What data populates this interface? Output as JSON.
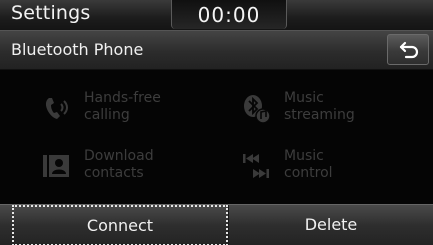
{
  "status_bar": {
    "app_title": "Settings",
    "clock": "00:00"
  },
  "header": {
    "title": "Bluetooth Phone",
    "back_icon": "back-arrow-icon"
  },
  "features": [
    {
      "label": "Hands-free\ncalling",
      "icon": "phone-icon",
      "enabled": false
    },
    {
      "label": "Music\nstreaming",
      "icon": "bluetooth-music-icon",
      "enabled": false
    },
    {
      "label": "Download\ncontacts",
      "icon": "contacts-card-icon",
      "enabled": false
    },
    {
      "label": "Music\ncontrol",
      "icon": "skip-track-icon",
      "enabled": false
    }
  ],
  "buttons": {
    "connect_label": "Connect",
    "delete_label": "Delete"
  },
  "colors": {
    "background": "#050505",
    "disabled_text": "#3d3d3d",
    "focus_outline": "#e6e6e6"
  }
}
